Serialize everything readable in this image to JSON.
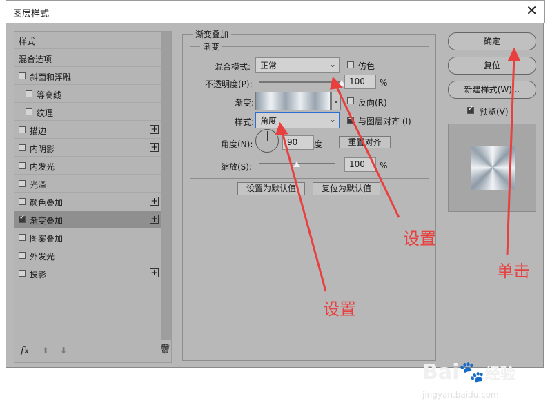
{
  "window": {
    "title": "图层样式"
  },
  "left_panel": {
    "items": [
      {
        "label": "样式",
        "checkbox": false,
        "plus": false,
        "checked": false,
        "indent": 0
      },
      {
        "label": "混合选项",
        "checkbox": false,
        "plus": false,
        "checked": false,
        "indent": 0
      },
      {
        "label": "斜面和浮雕",
        "checkbox": true,
        "plus": false,
        "checked": false,
        "indent": 0
      },
      {
        "label": "等高线",
        "checkbox": true,
        "plus": false,
        "checked": false,
        "indent": 1
      },
      {
        "label": "纹理",
        "checkbox": true,
        "plus": false,
        "checked": false,
        "indent": 1
      },
      {
        "label": "描边",
        "checkbox": true,
        "plus": true,
        "checked": false,
        "indent": 0
      },
      {
        "label": "内阴影",
        "checkbox": true,
        "plus": true,
        "checked": false,
        "indent": 0
      },
      {
        "label": "内发光",
        "checkbox": true,
        "plus": false,
        "checked": false,
        "indent": 0
      },
      {
        "label": "光泽",
        "checkbox": true,
        "plus": false,
        "checked": false,
        "indent": 0
      },
      {
        "label": "颜色叠加",
        "checkbox": true,
        "plus": true,
        "checked": false,
        "indent": 0
      },
      {
        "label": "渐变叠加",
        "checkbox": true,
        "plus": true,
        "checked": true,
        "indent": 0,
        "selected": true
      },
      {
        "label": "图案叠加",
        "checkbox": true,
        "plus": false,
        "checked": false,
        "indent": 0
      },
      {
        "label": "外发光",
        "checkbox": true,
        "plus": false,
        "checked": false,
        "indent": 0
      },
      {
        "label": "投影",
        "checkbox": true,
        "plus": true,
        "checked": false,
        "indent": 0
      }
    ],
    "fx_label": "fx"
  },
  "gradient_overlay": {
    "group_title": "渐变叠加",
    "sub_title": "渐变",
    "blend_mode_label": "混合模式:",
    "blend_mode_value": "正常",
    "dither_label": "仿色",
    "opacity_label": "不透明度(P):",
    "opacity_value": "100",
    "opacity_unit": "%",
    "opacity_fraction": 1.0,
    "gradient_label": "渐变:",
    "reverse_label": "反向(R)",
    "style_label": "样式:",
    "style_value": "角度",
    "align_label": "与图层对齐 (I)",
    "angle_label": "角度(N):",
    "angle_value": "90",
    "angle_unit": "度",
    "reset_align_label": "重置对齐",
    "scale_label": "缩放(S):",
    "scale_value": "100",
    "scale_unit": "%",
    "scale_fraction": 0.5,
    "set_default_label": "设置为默认值",
    "reset_default_label": "复位为默认值"
  },
  "right_panel": {
    "ok_label": "确定",
    "reset_label": "复位",
    "new_style_label": "新建样式(W)...",
    "preview_label": "预览(V)"
  },
  "annotations": {
    "set1": "设置",
    "set2": "设置",
    "click": "单击"
  },
  "watermark": {
    "brand": "Bai",
    "brand2": "经验",
    "url": "jingyan.baidu.com"
  },
  "colors": {
    "dialog_bg": "#b8b8b8",
    "annotation_red": "#e8403f"
  }
}
